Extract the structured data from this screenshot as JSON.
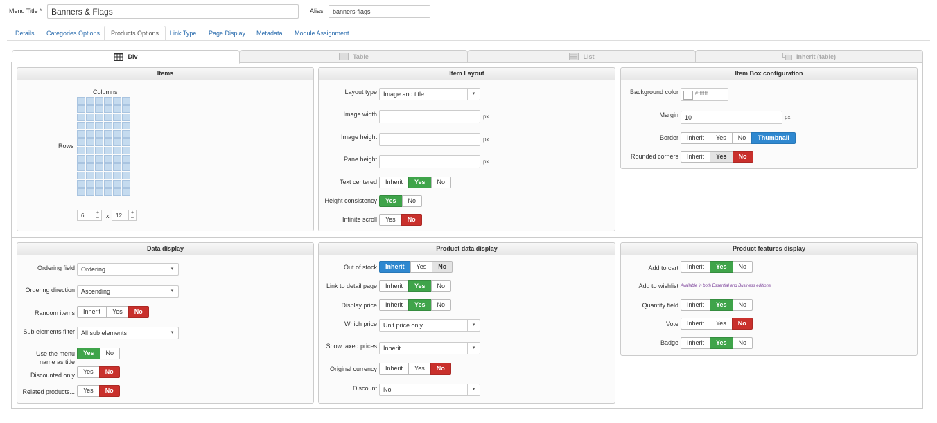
{
  "header": {
    "menu_title_label": "Menu Title *",
    "menu_title_value": "Banners & Flags",
    "alias_label": "Alias",
    "alias_value": "banners-flags"
  },
  "nav_tabs": [
    "Details",
    "Categories Options",
    "Products Options",
    "Link Type",
    "Page Display",
    "Metadata",
    "Module Assignment"
  ],
  "layout_tabs": [
    "Div",
    "Table",
    "List",
    "Inherit (table)"
  ],
  "items": {
    "title": "Items",
    "columns_label": "Columns",
    "rows_label": "Rows",
    "columns_value": "6",
    "rows_value": "12",
    "times": "x"
  },
  "item_layout": {
    "title": "Item Layout",
    "layout_type_label": "Layout type",
    "layout_type_value": "Image and title",
    "image_width_label": "Image width",
    "image_height_label": "Image height",
    "pane_height_label": "Pane height",
    "px": "px",
    "text_centered_label": "Text centered",
    "height_consistency_label": "Height consistency",
    "infinite_scroll_label": "Infinite scroll"
  },
  "item_box": {
    "title": "Item Box configuration",
    "background_color_label": "Background color",
    "background_color_value": "#ffffff",
    "margin_label": "Margin",
    "margin_value": "10",
    "border_label": "Border",
    "rounded_corners_label": "Rounded corners"
  },
  "data_display": {
    "title": "Data display",
    "ordering_field_label": "Ordering field",
    "ordering_field_value": "Ordering",
    "ordering_direction_label": "Ordering direction",
    "ordering_direction_value": "Ascending",
    "random_items_label": "Random items",
    "sub_elements_label": "Sub elements filter",
    "sub_elements_value": "All sub elements",
    "use_menu_name_label_1": "Use the menu",
    "use_menu_name_label_2": "name as title",
    "discounted_only_label": "Discounted only",
    "related_products_label": "Related products..."
  },
  "product_data": {
    "title": "Product data display",
    "out_of_stock_label": "Out of stock",
    "link_detail_label": "Link to detail page",
    "display_price_label": "Display price",
    "which_price_label": "Which price",
    "which_price_value": "Unit price only",
    "show_taxed_label": "Show taxed prices",
    "show_taxed_value": "Inherit",
    "original_currency_label": "Original currency",
    "discount_label": "Discount",
    "discount_value": "No"
  },
  "product_features": {
    "title": "Product features display",
    "add_to_cart_label": "Add to cart",
    "add_to_wishlist_label": "Add to wishlist",
    "wishlist_note": "Available in both Essential and Business editions",
    "quantity_field_label": "Quantity field",
    "vote_label": "Vote",
    "badge_label": "Badge"
  },
  "toggle": {
    "inherit": "Inherit",
    "yes": "Yes",
    "no": "No",
    "thumbnail": "Thumbnail"
  },
  "colors": {
    "green": "#3fa44a",
    "red": "#c9302c",
    "blue": "#2f88d0",
    "link": "#2a6cae"
  }
}
